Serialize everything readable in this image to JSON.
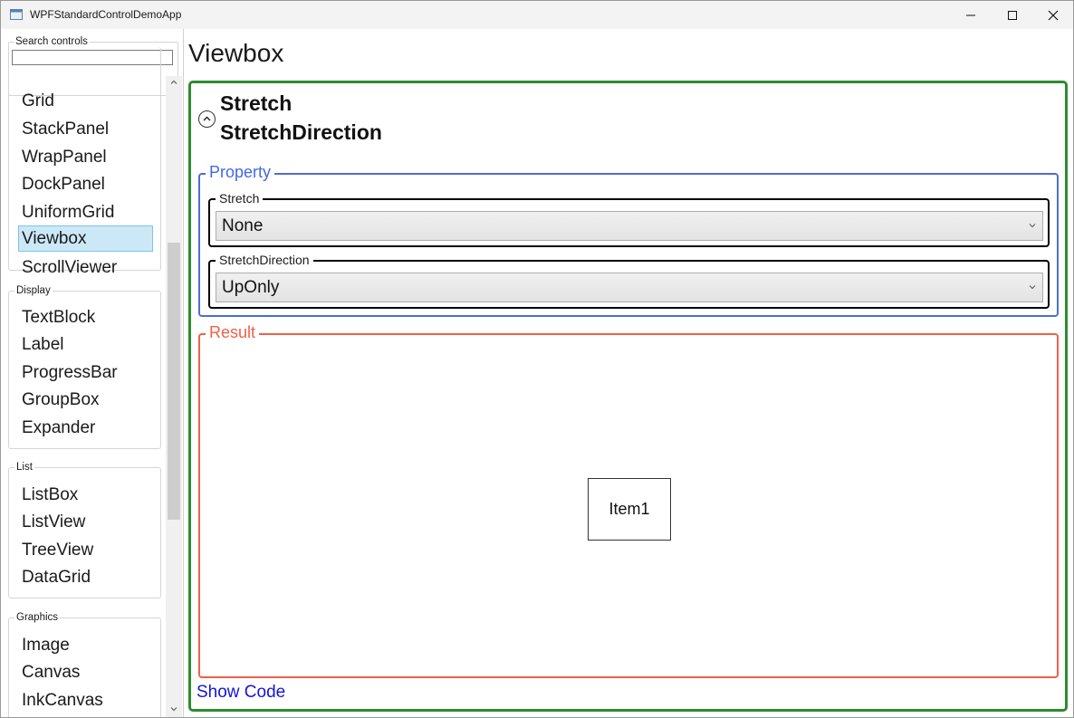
{
  "window": {
    "title": "WPFStandardControlDemoApp"
  },
  "sidebar": {
    "search": {
      "label": "Search controls",
      "value": ""
    },
    "layout_items": [
      "Grid",
      "StackPanel",
      "WrapPanel",
      "DockPanel",
      "UniformGrid",
      "Viewbox",
      "ScrollViewer"
    ],
    "selected": "Viewbox",
    "display": {
      "title": "Display",
      "items": [
        "TextBlock",
        "Label",
        "ProgressBar",
        "GroupBox",
        "Expander"
      ]
    },
    "list": {
      "title": "List",
      "items": [
        "ListBox",
        "ListView",
        "TreeView",
        "DataGrid"
      ]
    },
    "graphics": {
      "title": "Graphics",
      "items": [
        "Image",
        "Canvas",
        "InkCanvas"
      ]
    }
  },
  "main": {
    "page_title": "Viewbox",
    "expander": {
      "header_lines": [
        "Stretch",
        "StretchDirection"
      ]
    },
    "property": {
      "title": "Property",
      "stretch": {
        "label": "Stretch",
        "value": "None"
      },
      "stretch_direction": {
        "label": "StretchDirection",
        "value": "UpOnly"
      }
    },
    "result": {
      "title": "Result",
      "item_label": "Item1"
    },
    "show_code": "Show Code"
  },
  "colors": {
    "frame_green": "#2e8b2e",
    "property_blue": "#4169e1",
    "result_red": "#ef6048",
    "link_blue": "#1414d8",
    "selection": "#cce8f7"
  }
}
